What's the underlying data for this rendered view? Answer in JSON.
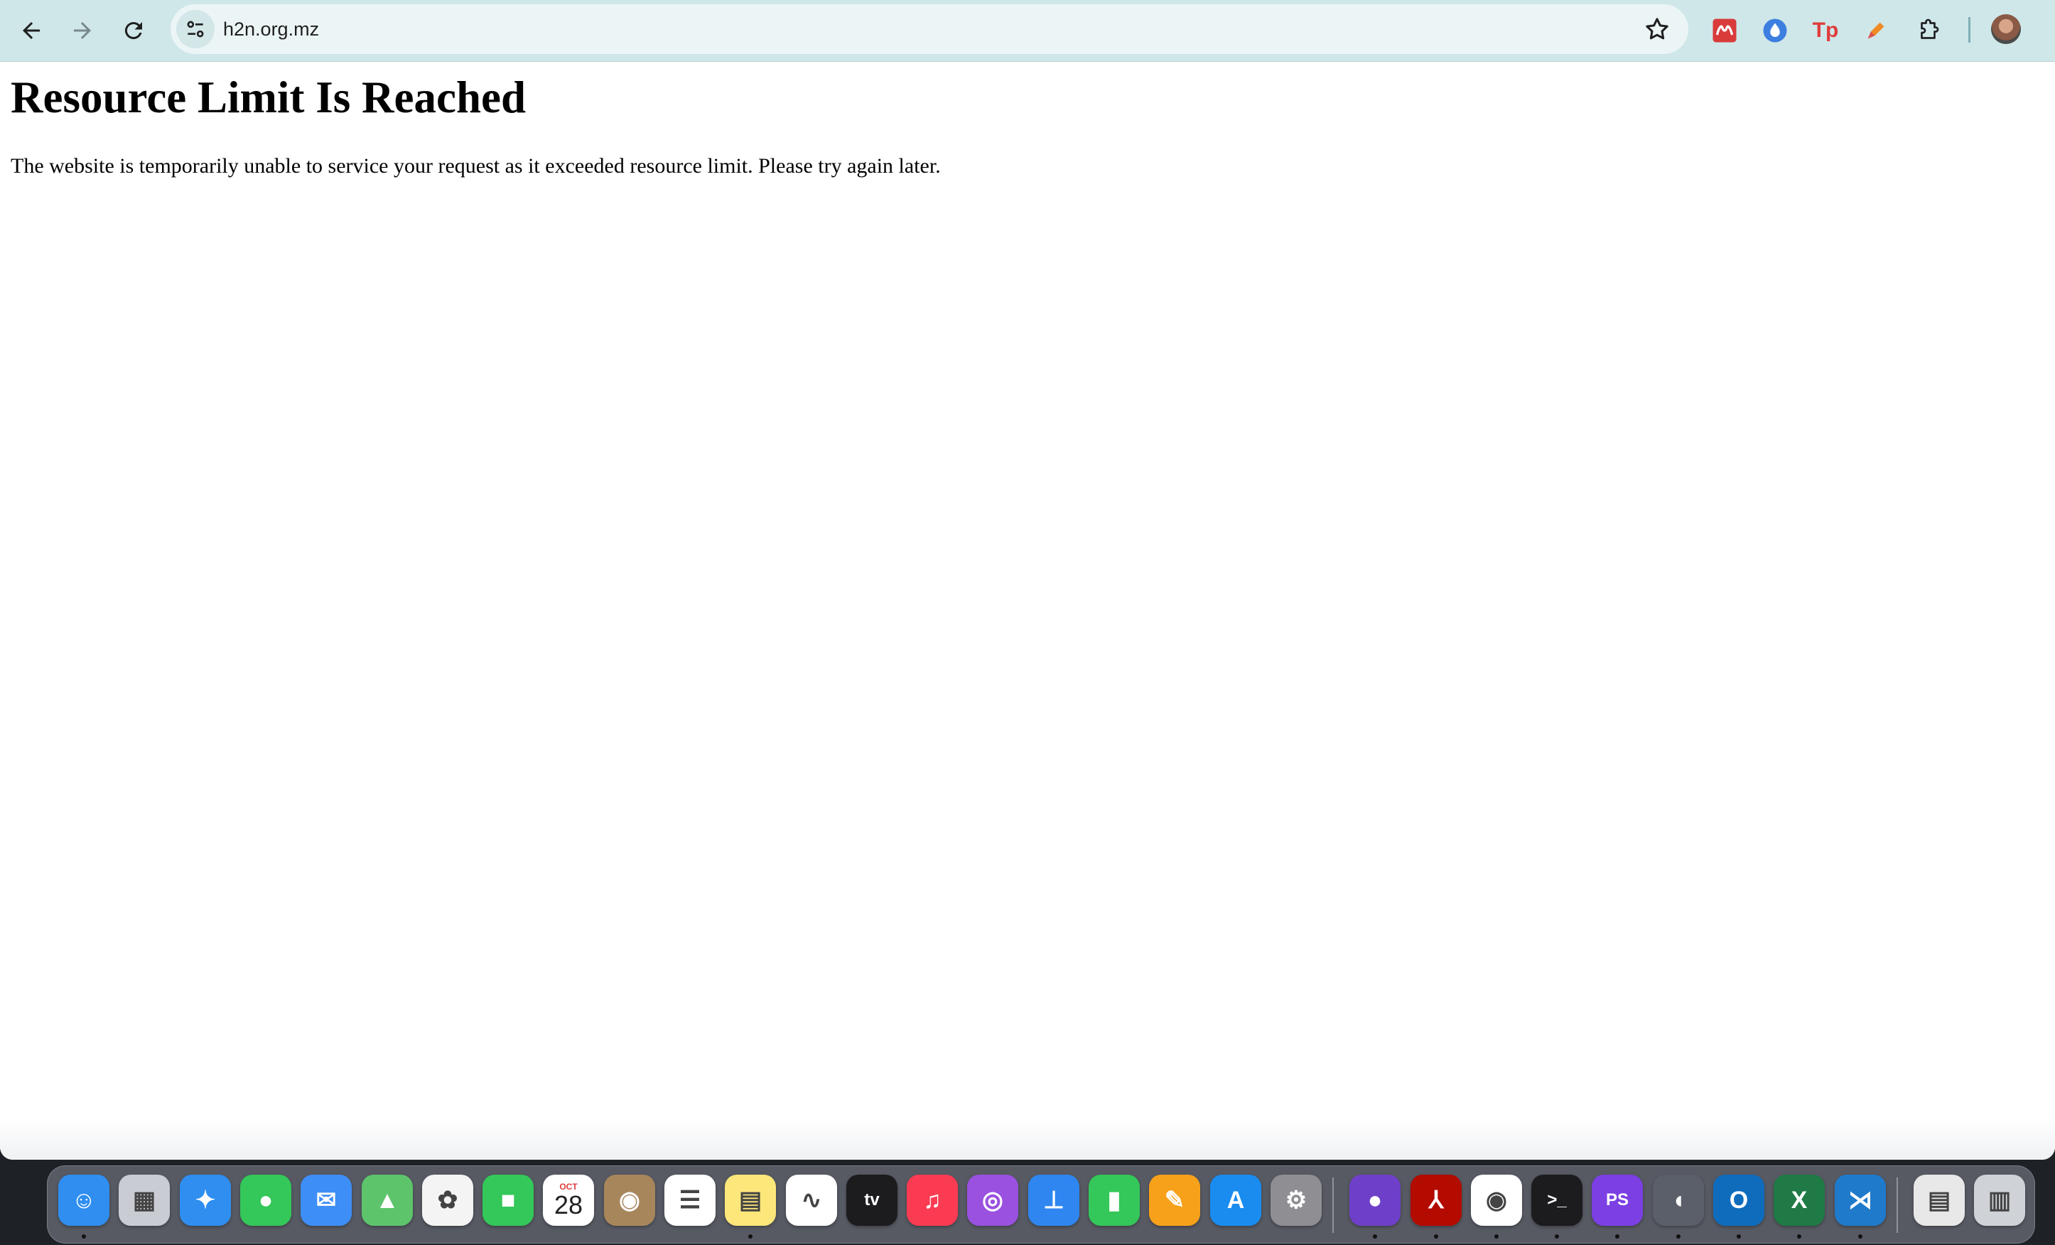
{
  "browser": {
    "url": "h2n.org.mz",
    "back_icon": "arrow-left-icon",
    "forward_icon": "arrow-right-icon",
    "reload_icon": "reload-icon",
    "site_info_icon": "tune-icon",
    "bookmark_icon": "star-icon",
    "extensions": [
      {
        "name": "mendeley-extension-icon",
        "color": "#d93b3b"
      },
      {
        "name": "droplet-extension-icon",
        "color": "#3d7fe0"
      },
      {
        "name": "tp-extension-icon",
        "color": "#e03c3c",
        "text": "Tp"
      },
      {
        "name": "pen-extension-icon",
        "color": "#f08a24"
      },
      {
        "name": "puzzle-extensions-icon",
        "color": "#202124"
      }
    ],
    "profile_icon": "avatar"
  },
  "page": {
    "heading": "Resource Limit Is Reached",
    "message": "The website is temporarily unable to service your request as it exceeded resource limit. Please try again later."
  },
  "dock": {
    "apps": [
      {
        "name": "finder",
        "color": "#2f8ef0",
        "glyph": "☺",
        "running": true
      },
      {
        "name": "launchpad",
        "color": "#c9ccd3",
        "glyph": "▦",
        "running": false
      },
      {
        "name": "safari",
        "color": "#2f8ef0",
        "glyph": "✦",
        "running": false
      },
      {
        "name": "messages",
        "color": "#34c759",
        "glyph": "●",
        "running": false
      },
      {
        "name": "mail",
        "color": "#3e8ef7",
        "glyph": "✉",
        "running": false
      },
      {
        "name": "maps",
        "color": "#5ec46c",
        "glyph": "▲",
        "running": false
      },
      {
        "name": "photos",
        "color": "#f4f4f4",
        "glyph": "✿",
        "running": false
      },
      {
        "name": "facetime",
        "color": "#34c759",
        "glyph": "■",
        "running": false
      },
      {
        "name": "calendar",
        "color": "#ffffff",
        "glyph": "28",
        "month": "OCT",
        "running": false
      },
      {
        "name": "contacts",
        "color": "#a8865c",
        "glyph": "◉",
        "running": false
      },
      {
        "name": "reminders",
        "color": "#ffffff",
        "glyph": "☰",
        "running": false
      },
      {
        "name": "notes",
        "color": "#fde77a",
        "glyph": "▤",
        "running": true
      },
      {
        "name": "freeform",
        "color": "#ffffff",
        "glyph": "∿",
        "running": false
      },
      {
        "name": "apple-tv",
        "color": "#1c1c1e",
        "glyph": "tv",
        "running": false
      },
      {
        "name": "music",
        "color": "#fa3b52",
        "glyph": "♫",
        "running": false
      },
      {
        "name": "podcasts",
        "color": "#9b51e0",
        "glyph": "◎",
        "running": false
      },
      {
        "name": "keynote",
        "color": "#2f86f0",
        "glyph": "⊥",
        "running": false
      },
      {
        "name": "numbers",
        "color": "#34c759",
        "glyph": "▮",
        "running": false
      },
      {
        "name": "pages",
        "color": "#f7a11a",
        "glyph": "✎",
        "running": false
      },
      {
        "name": "app-store",
        "color": "#1a8cf0",
        "glyph": "A",
        "running": false
      },
      {
        "name": "system-settings",
        "color": "#8e8e93",
        "glyph": "⚙",
        "running": false
      },
      {
        "name": "github-desktop",
        "color": "#6e40c9",
        "glyph": "●",
        "running": true
      },
      {
        "name": "acrobat",
        "color": "#b30b00",
        "glyph": "⅄",
        "running": true
      },
      {
        "name": "chrome",
        "color": "#ffffff",
        "glyph": "◉",
        "running": true
      },
      {
        "name": "terminal",
        "color": "#1c1c1e",
        "glyph": ">_",
        "running": true
      },
      {
        "name": "phpstorm",
        "color": "#7b3fe4",
        "glyph": "PS",
        "running": true
      },
      {
        "name": "tableplus",
        "color": "#5a5f69",
        "glyph": "◖",
        "running": true
      },
      {
        "name": "outlook",
        "color": "#0f6cbd",
        "glyph": "O",
        "running": true
      },
      {
        "name": "excel",
        "color": "#1f7a45",
        "glyph": "X",
        "running": true
      },
      {
        "name": "vscode",
        "color": "#1f7acb",
        "glyph": "⋊",
        "running": true
      },
      {
        "name": "documents-stack",
        "color": "#e8e8e8",
        "glyph": "▤",
        "running": false
      },
      {
        "name": "trash",
        "color": "#cfd2d6",
        "glyph": "▥",
        "running": false
      }
    ]
  }
}
